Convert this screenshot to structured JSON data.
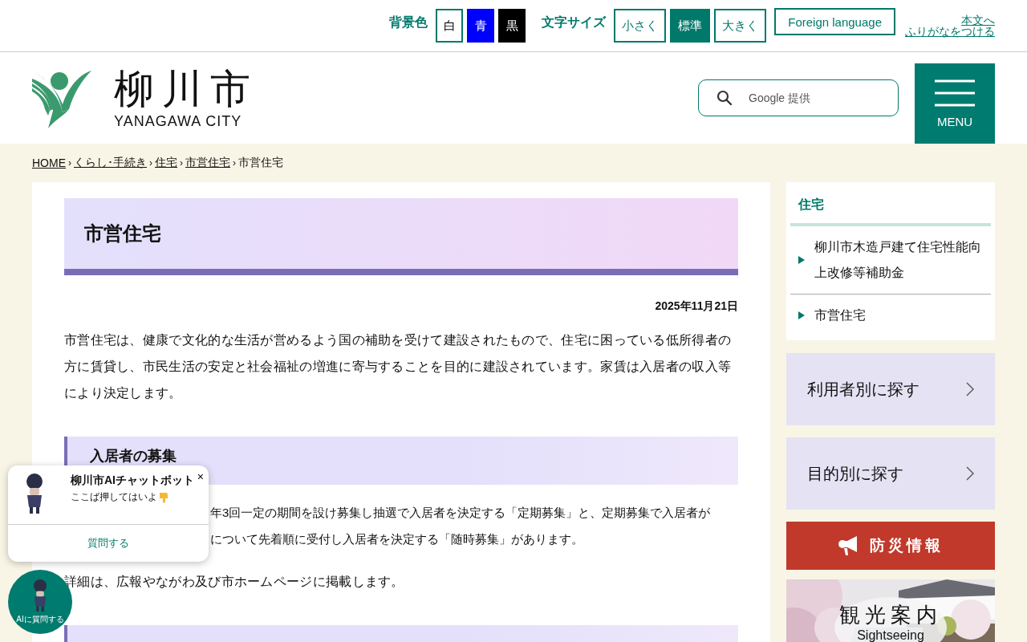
{
  "top_bar": {
    "background_label": "背景色",
    "background_options": [
      {
        "label": "白",
        "color": "#ffffff"
      },
      {
        "label": "青",
        "color": "#0000ff"
      },
      {
        "label": "黒",
        "color": "#000000"
      }
    ],
    "font_size_label": "文字サイズ",
    "font_sizes": [
      {
        "label": "小さく",
        "selected": false
      },
      {
        "label": "標準",
        "selected": true
      },
      {
        "label": "大きく",
        "selected": false
      }
    ],
    "language_button": "Foreign language",
    "reader_links": [
      "本文へ",
      "ふりがなをつける"
    ]
  },
  "header": {
    "logo_title": "柳川市",
    "logo_subtitle": "YANAGAWA CITY",
    "search": {
      "placeholder": "Google 提供"
    },
    "menu_label": "MENU"
  },
  "breadcrumb": {
    "separator": "›",
    "items": [
      {
        "label": "HOME",
        "current": false
      },
      {
        "label": "くらし･手続き",
        "current": false
      },
      {
        "label": "住宅",
        "current": false
      },
      {
        "label": "市営住宅",
        "current": false
      },
      {
        "label": "市営住宅",
        "current": true
      }
    ]
  },
  "main": {
    "title": "市営住宅",
    "date": "2025年11月21日",
    "intro": "市営住宅は、健康で文化的な生活が営めるよう国の補助を受けて建設されたもので、住宅に困っている低所得者の方に賃貸し、市民生活の安定と社会福祉の増進に寄与することを目的に建設されています。家賃は入居者の収入等により決定します。",
    "sections": [
      {
        "kind": "full",
        "heading": "入居者の募集",
        "paragraphs": [
          {
            "kind": "covered",
            "lines": [
              "年3回一定の期間を設け募集し抽選で入居者を決定する「定期募集」と、定期募集で入居者が",
              "について先着順に受付し入居者を決定する「随時募集」があります。"
            ]
          },
          {
            "kind": "text",
            "text": "詳細は、広報やながわ及び市ホームページに掲載します。"
          }
        ]
      },
      {
        "kind": "cut"
      }
    ]
  },
  "sidebar": {
    "nav_title": "住宅",
    "nav_items": [
      "柳川市木造戸建て住宅性能向上改修等補助金",
      "市営住宅"
    ],
    "search_buttons": [
      "利用者別に探す",
      "目的別に探す"
    ],
    "disaster_banner": "防災情報",
    "sightseeing_banner": {
      "kind": "picture",
      "title": "観光案内",
      "subtitle": "Sightseeing"
    }
  },
  "chatbot": {
    "title": "柳川市AIチャットボット",
    "close": "×",
    "message": "ここば押してはいよ",
    "action": "質問する",
    "fab_label": "AIに質問する"
  }
}
